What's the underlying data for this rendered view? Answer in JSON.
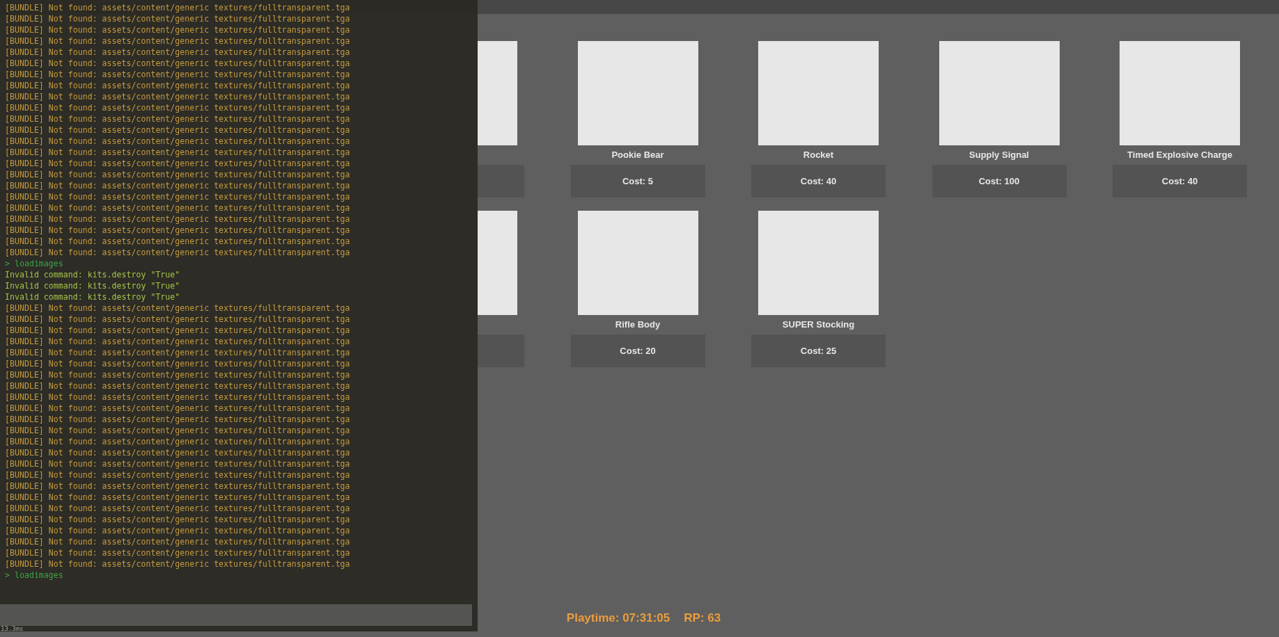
{
  "shop": {
    "items": [
      {
        "kind": "covered"
      },
      {
        "kind": "covered"
      },
      {
        "kind": "partial"
      },
      {
        "name": "Pookie Bear",
        "cost": "Cost: 5"
      },
      {
        "name": "Rocket",
        "cost": "Cost: 40"
      },
      {
        "name": "Supply Signal",
        "cost": "Cost: 100"
      },
      {
        "name": "Timed Explosive Charge",
        "cost": "Cost: 40"
      },
      {
        "kind": "covered"
      },
      {
        "kind": "covered"
      },
      {
        "kind": "partial"
      },
      {
        "name": "Rifle Body",
        "cost": "Cost: 20"
      },
      {
        "name": "SUPER Stocking",
        "cost": "Cost: 25"
      }
    ]
  },
  "console": {
    "lines": [
      {
        "kind": "warning",
        "text": "[BUNDLE] Not found: assets/content/generic textures/fulltransparent.tga"
      },
      {
        "kind": "warning",
        "text": "[BUNDLE] Not found: assets/content/generic textures/fulltransparent.tga"
      },
      {
        "kind": "warning",
        "text": "[BUNDLE] Not found: assets/content/generic textures/fulltransparent.tga"
      },
      {
        "kind": "warning",
        "text": "[BUNDLE] Not found: assets/content/generic textures/fulltransparent.tga"
      },
      {
        "kind": "warning",
        "text": "[BUNDLE] Not found: assets/content/generic textures/fulltransparent.tga"
      },
      {
        "kind": "warning",
        "text": "[BUNDLE] Not found: assets/content/generic textures/fulltransparent.tga"
      },
      {
        "kind": "warning",
        "text": "[BUNDLE] Not found: assets/content/generic textures/fulltransparent.tga"
      },
      {
        "kind": "warning",
        "text": "[BUNDLE] Not found: assets/content/generic textures/fulltransparent.tga"
      },
      {
        "kind": "warning",
        "text": "[BUNDLE] Not found: assets/content/generic textures/fulltransparent.tga"
      },
      {
        "kind": "warning",
        "text": "[BUNDLE] Not found: assets/content/generic textures/fulltransparent.tga"
      },
      {
        "kind": "warning",
        "text": "[BUNDLE] Not found: assets/content/generic textures/fulltransparent.tga"
      },
      {
        "kind": "warning",
        "text": "[BUNDLE] Not found: assets/content/generic textures/fulltransparent.tga"
      },
      {
        "kind": "warning",
        "text": "[BUNDLE] Not found: assets/content/generic textures/fulltransparent.tga"
      },
      {
        "kind": "warning",
        "text": "[BUNDLE] Not found: assets/content/generic textures/fulltransparent.tga"
      },
      {
        "kind": "warning",
        "text": "[BUNDLE] Not found: assets/content/generic textures/fulltransparent.tga"
      },
      {
        "kind": "warning",
        "text": "[BUNDLE] Not found: assets/content/generic textures/fulltransparent.tga"
      },
      {
        "kind": "warning",
        "text": "[BUNDLE] Not found: assets/content/generic textures/fulltransparent.tga"
      },
      {
        "kind": "warning",
        "text": "[BUNDLE] Not found: assets/content/generic textures/fulltransparent.tga"
      },
      {
        "kind": "warning",
        "text": "[BUNDLE] Not found: assets/content/generic textures/fulltransparent.tga"
      },
      {
        "kind": "warning",
        "text": "[BUNDLE] Not found: assets/content/generic textures/fulltransparent.tga"
      },
      {
        "kind": "warning",
        "text": "[BUNDLE] Not found: assets/content/generic textures/fulltransparent.tga"
      },
      {
        "kind": "warning",
        "text": "[BUNDLE] Not found: assets/content/generic textures/fulltransparent.tga"
      },
      {
        "kind": "warning",
        "text": "[BUNDLE] Not found: assets/content/generic textures/fulltransparent.tga"
      },
      {
        "kind": "command",
        "text": "> loadimages"
      },
      {
        "kind": "error",
        "text": "Invalid command: kits.destroy \"True\""
      },
      {
        "kind": "error",
        "text": "Invalid command: kits.destroy \"True\""
      },
      {
        "kind": "error",
        "text": "Invalid command: kits.destroy \"True\""
      },
      {
        "kind": "warning",
        "text": "[BUNDLE] Not found: assets/content/generic textures/fulltransparent.tga"
      },
      {
        "kind": "warning",
        "text": "[BUNDLE] Not found: assets/content/generic textures/fulltransparent.tga"
      },
      {
        "kind": "warning",
        "text": "[BUNDLE] Not found: assets/content/generic textures/fulltransparent.tga"
      },
      {
        "kind": "warning",
        "text": "[BUNDLE] Not found: assets/content/generic textures/fulltransparent.tga"
      },
      {
        "kind": "warning",
        "text": "[BUNDLE] Not found: assets/content/generic textures/fulltransparent.tga"
      },
      {
        "kind": "warning",
        "text": "[BUNDLE] Not found: assets/content/generic textures/fulltransparent.tga"
      },
      {
        "kind": "warning",
        "text": "[BUNDLE] Not found: assets/content/generic textures/fulltransparent.tga"
      },
      {
        "kind": "warning",
        "text": "[BUNDLE] Not found: assets/content/generic textures/fulltransparent.tga"
      },
      {
        "kind": "warning",
        "text": "[BUNDLE] Not found: assets/content/generic textures/fulltransparent.tga"
      },
      {
        "kind": "warning",
        "text": "[BUNDLE] Not found: assets/content/generic textures/fulltransparent.tga"
      },
      {
        "kind": "warning",
        "text": "[BUNDLE] Not found: assets/content/generic textures/fulltransparent.tga"
      },
      {
        "kind": "warning",
        "text": "[BUNDLE] Not found: assets/content/generic textures/fulltransparent.tga"
      },
      {
        "kind": "warning",
        "text": "[BUNDLE] Not found: assets/content/generic textures/fulltransparent.tga"
      },
      {
        "kind": "warning",
        "text": "[BUNDLE] Not found: assets/content/generic textures/fulltransparent.tga"
      },
      {
        "kind": "warning",
        "text": "[BUNDLE] Not found: assets/content/generic textures/fulltransparent.tga"
      },
      {
        "kind": "warning",
        "text": "[BUNDLE] Not found: assets/content/generic textures/fulltransparent.tga"
      },
      {
        "kind": "warning",
        "text": "[BUNDLE] Not found: assets/content/generic textures/fulltransparent.tga"
      },
      {
        "kind": "warning",
        "text": "[BUNDLE] Not found: assets/content/generic textures/fulltransparent.tga"
      },
      {
        "kind": "warning",
        "text": "[BUNDLE] Not found: assets/content/generic textures/fulltransparent.tga"
      },
      {
        "kind": "warning",
        "text": "[BUNDLE] Not found: assets/content/generic textures/fulltransparent.tga"
      },
      {
        "kind": "warning",
        "text": "[BUNDLE] Not found: assets/content/generic textures/fulltransparent.tga"
      },
      {
        "kind": "warning",
        "text": "[BUNDLE] Not found: assets/content/generic textures/fulltransparent.tga"
      },
      {
        "kind": "warning",
        "text": "[BUNDLE] Not found: assets/content/generic textures/fulltransparent.tga"
      },
      {
        "kind": "warning",
        "text": "[BUNDLE] Not found: assets/content/generic textures/fulltransparent.tga"
      },
      {
        "kind": "command",
        "text": "> loadimages"
      }
    ],
    "frame_time": "13.3ms"
  },
  "status": {
    "playtime": "Playtime: 07:31:05",
    "rp": "RP: 63"
  }
}
